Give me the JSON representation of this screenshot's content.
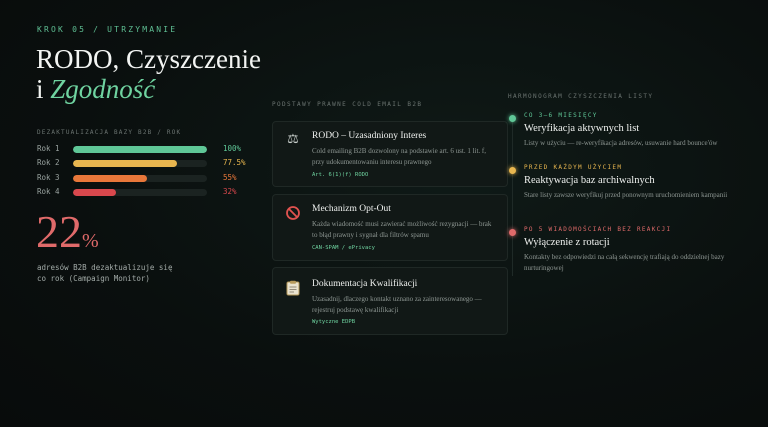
{
  "header": {
    "eyebrow": "KROK 05 / UTRZYMANIE",
    "title_line1": "RODO, Czyszczenie",
    "title_line2_prefix": "i ",
    "title_line2_accent": "Zgodność"
  },
  "decay": {
    "heading": "DEZAKTUALIZACJA BAZY B2B / ROK",
    "rows": [
      {
        "label": "Rok 1",
        "value": "100%",
        "fraction": 1.0,
        "color": "#5fc797"
      },
      {
        "label": "Rok 2",
        "value": "77.5%",
        "fraction": 0.775,
        "color": "#e8b64f"
      },
      {
        "label": "Rok 3",
        "value": "55%",
        "fraction": 0.55,
        "color": "#e8773a"
      },
      {
        "label": "Rok 4",
        "value": "32%",
        "fraction": 0.32,
        "color": "#d9484d"
      }
    ],
    "big_number": "22",
    "big_unit": "%",
    "desc_line1": "adresów B2B dezaktualizuje się",
    "desc_line2": "co rok (Campaign Monitor)"
  },
  "legal": {
    "heading": "PODSTAWY PRAWNE COLD EMAIL B2B",
    "cards": [
      {
        "icon": "scales-icon",
        "title": "RODO – Uzasadniony Interes",
        "body": "Cold emailing B2B dozwolony na podstawie art. 6 ust. 1 lit. f, przy udokumentowaniu interesu prawnego",
        "tag": "Art. 6(1)(f) RODO"
      },
      {
        "icon": "prohibited-icon",
        "title": "Mechanizm Opt-Out",
        "body": "Każda wiadomość musi zawierać możliwość rezygnacji — brak to błąd prawny i sygnał dla filtrów spamu",
        "tag": "CAN-SPAM / ePrivacy"
      },
      {
        "icon": "clipboard-icon",
        "title": "Dokumentacja Kwalifikacji",
        "body": "Uzasadnij, dlaczego kontakt uznano za zainteresowanego — rejestruj podstawę kwalifikacji",
        "tag": "Wytyczne EDPB"
      }
    ]
  },
  "schedule": {
    "heading": "HARMONOGRAM CZYSZCZENIA LISTY",
    "steps": [
      {
        "label": "CO 3–6 MIESIĘCY",
        "color": "#5fc797",
        "title": "Weryfikacja aktywnych list",
        "body": "Listy w użyciu — re-weryfikacja adresów, usuwanie hard bounce'ów"
      },
      {
        "label": "PRZED KAŻDYM UŻYCIEM",
        "color": "#e8b64f",
        "title": "Reaktywacja baz archiwalnych",
        "body": "Stare listy zawsze weryfikuj przed ponownym uruchomieniem kampanii"
      },
      {
        "label": "PO 5 WIADOMOŚCIACH BEZ REAKCJI",
        "color": "#e06a6a",
        "title": "Wyłączenie z rotacji",
        "body": "Kontakty bez odpowiedzi na całą sekwencję trafiają do oddzielnej bazy nurturingowej"
      }
    ]
  }
}
